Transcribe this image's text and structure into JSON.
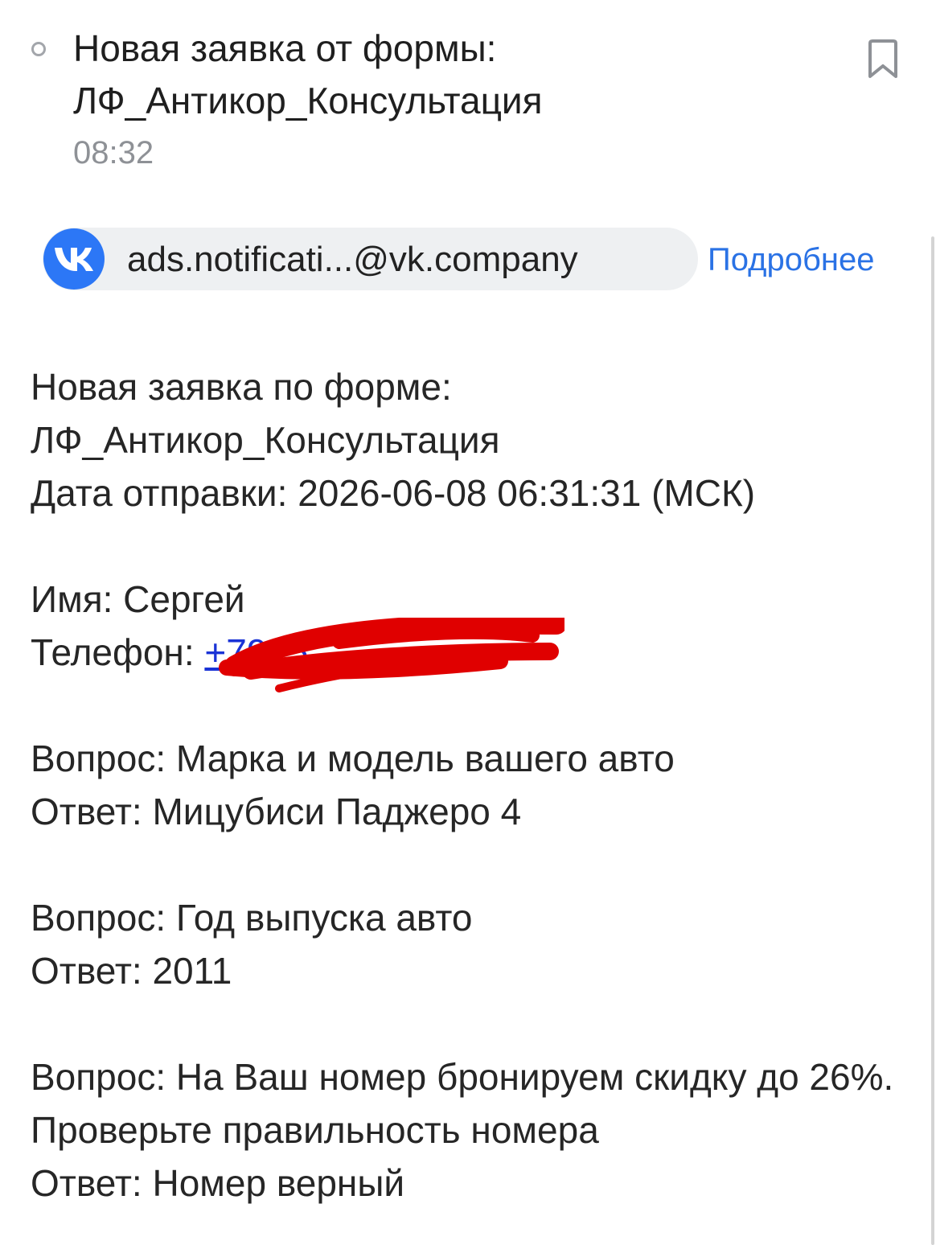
{
  "header": {
    "subject_line1": "Новая заявка от формы:",
    "subject_line2": "ЛФ_Антикор_Консультация",
    "time": "08:32",
    "bookmark_icon": "bookmark-icon"
  },
  "sender": {
    "avatar_icon": "vk-logo-icon",
    "avatar_color": "#2c77f6",
    "email": "ads.notificati...@vk.company",
    "details_label": "Подробнее"
  },
  "message": {
    "line1": "Новая заявка по форме:",
    "line2": "ЛФ_Антикор_Консультация",
    "date_label": "Дата отправки:",
    "date_value": "2026-06-08 06:31:31 (МСК)",
    "name_label": "Имя:",
    "name_value": "Сергей",
    "phone_label": "Телефон:",
    "phone_value": "+7915",
    "qa": [
      {
        "question_label": "Вопрос:",
        "question": "Марка и модель вашего авто",
        "answer_label": "Ответ:",
        "answer": "Мицубиси Паджеро 4"
      },
      {
        "question_label": "Вопрос:",
        "question": "Год выпуска авто",
        "answer_label": "Ответ:",
        "answer": "2011"
      },
      {
        "question_label": "Вопрос:",
        "question": "На Ваш номер бронируем скидку до 26%. Проверьте правильность номера",
        "answer_label": "Ответ:",
        "answer": "Номер верный"
      }
    ]
  },
  "colors": {
    "link": "#2a72e5",
    "phone_link": "#1a33d6",
    "redaction": "#e00000",
    "muted": "#8e9196"
  }
}
